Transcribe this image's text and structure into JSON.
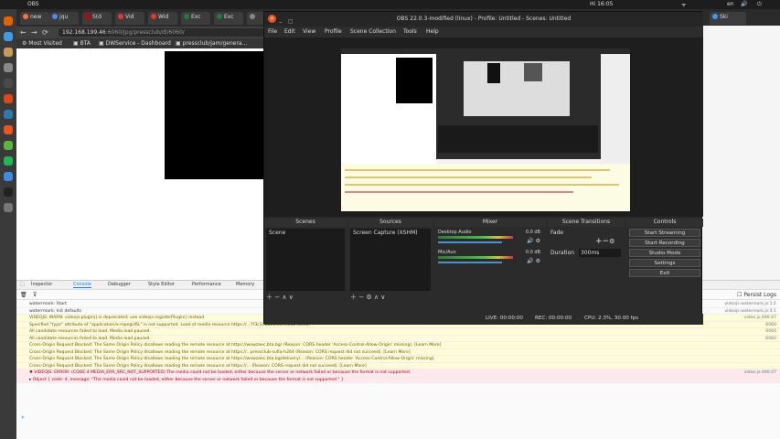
{
  "topbar": {
    "activities": "OBS",
    "clock": "Hi 16:05",
    "indicators": [
      "en",
      "ᯤ",
      "🔊",
      "⏻"
    ]
  },
  "dock_icons": [
    {
      "name": "firefox-icon",
      "color": "#e66000"
    },
    {
      "name": "chrome-icon",
      "color": "#3d9ae8"
    },
    {
      "name": "files-icon",
      "color": "#c79a56"
    },
    {
      "name": "settings-icon",
      "color": "#888888"
    },
    {
      "name": "terminal-icon",
      "color": "#4a4a4a"
    },
    {
      "name": "text-editor-icon",
      "color": "#dd4814"
    },
    {
      "name": "calendar-icon",
      "color": "#2a7ab0"
    },
    {
      "name": "software-icon",
      "color": "#e95420"
    },
    {
      "name": "apps-icon",
      "color": "#5db33b"
    },
    {
      "name": "spotify-icon",
      "color": "#1db954"
    },
    {
      "name": "vscode-icon",
      "color": "#3f8ae0"
    },
    {
      "name": "obs-icon",
      "color": "#222222"
    },
    {
      "name": "trash-icon",
      "color": "#777777"
    }
  ],
  "browser": {
    "tabs": [
      "new",
      "jqu",
      "S(d",
      "Vid",
      "Wid",
      "Exc",
      "Exc",
      "",
      "Ski"
    ],
    "url_host": "192.168.199.46",
    "url_path": ":6060/jpg/pressclub/dl/6060/",
    "bookmarks": [
      "Most Visited",
      "BTA",
      "DWService - Dashboard",
      "pressclub/jam/genera..."
    ]
  },
  "devtools": {
    "tabs": [
      "Inspector",
      "Console",
      "Debugger",
      "Style Editor",
      "Performance",
      "Memory"
    ],
    "selected_tab": "Console",
    "persist_logs": "Persist Logs",
    "messages": [
      {
        "type": "info",
        "text": "waterrmark: Start",
        "src": "videojs.watermark.js:1:1"
      },
      {
        "type": "info",
        "text": "waterrmark: Init defaults",
        "src": "videojs.watermark.js:4:1"
      },
      {
        "type": "warn",
        "text": "VIDEOJS: WARN: videojs.plugin() is deprecated; use videojs.registerPlugin() instead",
        "src": "video.js:490:47"
      },
      {
        "type": "warn",
        "text": "Specified \"type\" attribute of \"application/x-mpegURL\" is not supported. Load of media resource https://...7f3c3e6a13f6d.m3u8 failed.",
        "src": "6060"
      },
      {
        "type": "warn",
        "text": "All candidate resources failed to load. Media load paused.",
        "src": "6060"
      },
      {
        "type": "warn",
        "text": "All candidate resources failed to load. Media load paused.",
        "src": "6060"
      },
      {
        "type": "warn",
        "text": "Cross-Origin Request Blocked: The Same Origin Policy disallows reading the remote resource at https://wowzaec.bta.bg/ (Reason: CORS header 'Access-Control-Allow-Origin' missing). [Learn More]",
        "src": ""
      },
      {
        "type": "warn",
        "text": "Cross-Origin Request Blocked: The Same Origin Policy disallows reading the remote resource at https://...pressclub-sufia-h264 (Reason: CORS request did not succeed). [Learn More]",
        "src": ""
      },
      {
        "type": "warn",
        "text": "Cross-Origin Request Blocked: The Same Origin Policy disallows reading the remote resource at https://wowzaec.bta.bg/delivery/... (Reason: CORS header 'Access-Control-Allow-Origin' missing).",
        "src": ""
      },
      {
        "type": "warn",
        "text": "Cross-Origin Request Blocked: The Same Origin Policy disallows reading the remote resource at https://... (Reason: CORS request did not succeed). [Learn More]",
        "src": ""
      },
      {
        "type": "err",
        "text": "✖ VIDEOJS: ERROR: (CODE:4 MEDIA_ERR_SRC_NOT_SUPPORTED) The media could not be loaded, either because the server or network failed or because the format is not supported.",
        "src": "video.js:490:47"
      },
      {
        "type": "err",
        "text": "▸ Object { code: 4, message: \"The media could not be loaded, either because the server or network failed or because the format is not supported.\" }",
        "src": ""
      }
    ],
    "prompt": "»"
  },
  "obs": {
    "title": "OBS 22.0.3-modified (linux) - Profile: Untitled - Scenes: Untitled",
    "menu": [
      "File",
      "Edit",
      "View",
      "Profile",
      "Scene Collection",
      "Tools",
      "Help"
    ],
    "scenes_title": "Scenes",
    "scenes": [
      "Scene"
    ],
    "sources_title": "Sources",
    "sources": [
      "Screen Capture (XSHM)"
    ],
    "mixer_title": "Mixer",
    "mixer": [
      {
        "name": "Desktop Audio",
        "db": "0.0 dB",
        "level": 0.85
      },
      {
        "name": "Mic/Aux",
        "db": "0.0 dB",
        "level": 0.85
      }
    ],
    "transitions_title": "Scene Transitions",
    "transition": "Fade",
    "duration_label": "Duration",
    "duration_value": "300ms",
    "controls_title": "Controls",
    "controls": [
      "Start Streaming",
      "Start Recording",
      "Studio Mode",
      "Settings",
      "Exit"
    ],
    "status": {
      "live": "LIVE: 00:00:00",
      "rec": "REC: 00:00:00",
      "cpu": "CPU: 2.3%, 30.00 fps"
    }
  }
}
